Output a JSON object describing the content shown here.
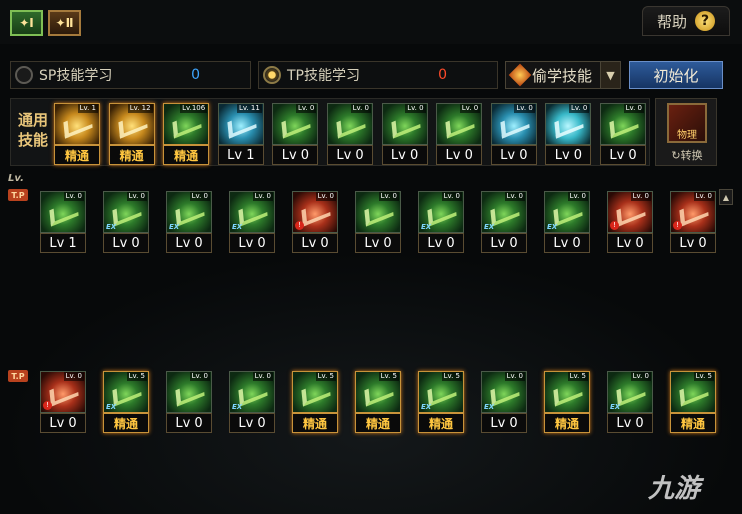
{
  "top": {
    "tab1_label": "✦Ⅰ",
    "tab2_label": "✦Ⅱ",
    "help_label": "帮助",
    "help_icon": "?"
  },
  "points": {
    "sp_label": "SP技能学习",
    "sp_value": "0",
    "tp_label": "TP技能学习",
    "tp_value": "0",
    "steal_label": "偷学技能",
    "steal_dropdown": "▼",
    "reset_label": "初始化"
  },
  "common": {
    "label": "通用\n技能",
    "swap_icon_text": "物理",
    "swap_label": "↻转换",
    "skills": [
      {
        "level_tag": "Lv. 1",
        "plate": "精通",
        "master": true,
        "style": "yellow"
      },
      {
        "level_tag": "Lv. 12",
        "plate": "精通",
        "master": true,
        "style": "yellow"
      },
      {
        "level_tag": "Lv.106",
        "plate": "精通",
        "master": true,
        "style": "green"
      },
      {
        "level_tag": "Lv. 11",
        "plate": "Lv 1",
        "master": false,
        "style": "blue"
      },
      {
        "level_tag": "Lv. 0",
        "plate": "Lv 0",
        "master": false,
        "style": "green"
      },
      {
        "level_tag": "Lv. 0",
        "plate": "Lv 0",
        "master": false,
        "style": "green"
      },
      {
        "level_tag": "Lv. 0",
        "plate": "Lv 0",
        "master": false,
        "style": "green"
      },
      {
        "level_tag": "Lv. 0",
        "plate": "Lv 0",
        "master": false,
        "style": "green"
      },
      {
        "level_tag": "Lv. 0",
        "plate": "Lv 0",
        "master": false,
        "style": "blue"
      },
      {
        "level_tag": "Lv. 0",
        "plate": "Lv 0",
        "master": false,
        "style": "cyan"
      },
      {
        "level_tag": "Lv. 0",
        "plate": "Lv 0",
        "master": false,
        "style": "green"
      }
    ]
  },
  "tree": {
    "lv_label": "Lv.",
    "tp_tag": "T.P",
    "row1": [
      {
        "level_tag": "Lv. 0",
        "plate": "Lv 1",
        "master": false,
        "style": "green",
        "mark": ""
      },
      {
        "level_tag": "Lv. 0",
        "plate": "Lv 0",
        "master": false,
        "style": "green",
        "mark": "EX"
      },
      {
        "level_tag": "Lv. 0",
        "plate": "Lv 0",
        "master": false,
        "style": "green",
        "mark": "EX"
      },
      {
        "level_tag": "Lv. 0",
        "plate": "Lv 0",
        "master": false,
        "style": "green",
        "mark": "EX"
      },
      {
        "level_tag": "Lv. 0",
        "plate": "Lv 0",
        "master": false,
        "style": "red",
        "mark": "!"
      },
      {
        "level_tag": "Lv. 0",
        "plate": "Lv 0",
        "master": false,
        "style": "green",
        "mark": ""
      },
      {
        "level_tag": "Lv. 0",
        "plate": "Lv 0",
        "master": false,
        "style": "green",
        "mark": "EX"
      },
      {
        "level_tag": "Lv. 0",
        "plate": "Lv 0",
        "master": false,
        "style": "green",
        "mark": "EX"
      },
      {
        "level_tag": "Lv. 0",
        "plate": "Lv 0",
        "master": false,
        "style": "green",
        "mark": "EX"
      },
      {
        "level_tag": "Lv. 0",
        "plate": "Lv 0",
        "master": false,
        "style": "red",
        "mark": "!"
      },
      {
        "level_tag": "Lv. 0",
        "plate": "Lv 0",
        "master": false,
        "style": "red",
        "mark": "!"
      }
    ],
    "row2": [
      {
        "level_tag": "Lv. 0",
        "plate": "Lv 0",
        "master": false,
        "style": "red",
        "mark": "!"
      },
      {
        "level_tag": "Lv. 5",
        "plate": "精通",
        "master": true,
        "style": "green",
        "mark": "EX"
      },
      {
        "level_tag": "Lv. 0",
        "plate": "Lv 0",
        "master": false,
        "style": "green",
        "mark": ""
      },
      {
        "level_tag": "Lv. 0",
        "plate": "Lv 0",
        "master": false,
        "style": "green",
        "mark": "EX"
      },
      {
        "level_tag": "Lv. 5",
        "plate": "精通",
        "master": true,
        "style": "green",
        "mark": ""
      },
      {
        "level_tag": "Lv. 5",
        "plate": "精通",
        "master": true,
        "style": "green",
        "mark": ""
      },
      {
        "level_tag": "Lv. 5",
        "plate": "精通",
        "master": true,
        "style": "green",
        "mark": "EX"
      },
      {
        "level_tag": "Lv. 0",
        "plate": "Lv 0",
        "master": false,
        "style": "green",
        "mark": "EX"
      },
      {
        "level_tag": "Lv. 5",
        "plate": "精通",
        "master": true,
        "style": "green",
        "mark": ""
      },
      {
        "level_tag": "Lv. 0",
        "plate": "Lv 0",
        "master": false,
        "style": "green",
        "mark": "EX"
      },
      {
        "level_tag": "Lv. 5",
        "plate": "精通",
        "master": true,
        "style": "green",
        "mark": ""
      }
    ]
  },
  "watermark": "九游"
}
